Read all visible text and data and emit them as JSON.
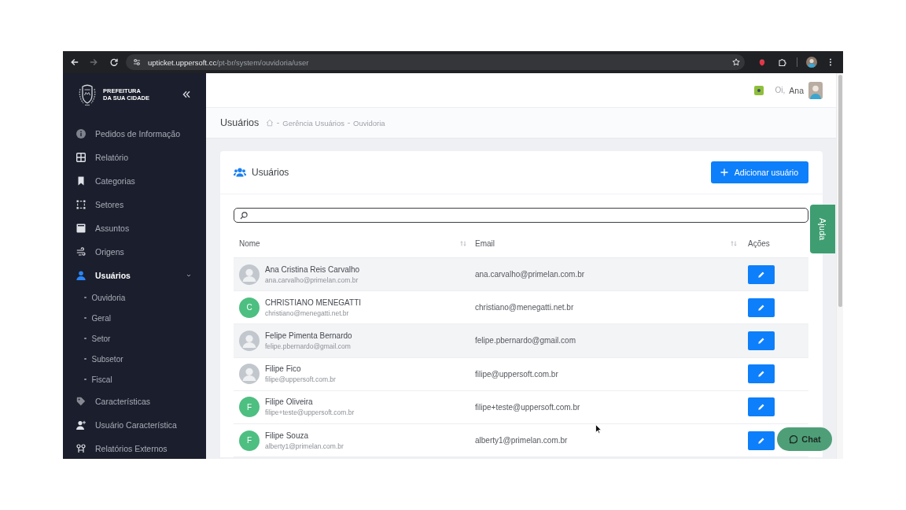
{
  "browser": {
    "back_disabled": false,
    "forward_disabled": true,
    "url": {
      "host": "upticket.uppersoft.cc",
      "path": "/pt-br/system/ouvidoria/user"
    }
  },
  "sidebar": {
    "brand": [
      "PREFEITURA",
      "DA SUA CIDADE"
    ],
    "items": [
      {
        "label": "Pedidos de Informação",
        "selected": false
      },
      {
        "label": "Relatório",
        "selected": false
      },
      {
        "label": "Categorias",
        "selected": false
      },
      {
        "label": "Setores",
        "selected": false
      },
      {
        "label": "Assuntos",
        "selected": false
      },
      {
        "label": "Origens",
        "selected": false
      },
      {
        "label": "Usuários",
        "selected": true,
        "expanded": true,
        "children": [
          {
            "label": "Ouvidoria"
          },
          {
            "label": "Geral"
          },
          {
            "label": "Setor"
          },
          {
            "label": "Subsetor"
          },
          {
            "label": "Fiscal"
          }
        ]
      },
      {
        "label": "Características",
        "selected": false
      },
      {
        "label": "Usuário Característica",
        "selected": false
      },
      {
        "label": "Relatórios Externos",
        "selected": false
      }
    ]
  },
  "header": {
    "greeting": "Oi,",
    "user_name": "Ana"
  },
  "page": {
    "title": "Usuários",
    "breadcrumb": [
      "Gerência Usuários",
      "Ouvidoria"
    ]
  },
  "card": {
    "title": "Usuários",
    "add_button": "Adicionar usuário",
    "table": {
      "columns": [
        {
          "label": "Nome",
          "sortable": true
        },
        {
          "label": "Email",
          "sortable": true
        },
        {
          "label": "Ações",
          "sortable": false
        }
      ],
      "rows": [
        {
          "name": "Ana Cristina Reis Carvalho",
          "sub_email": "ana.carvalho@primelan.com.br",
          "email": "ana.carvalho@primelan.com.br",
          "avatar": {
            "kind": "photo"
          },
          "shaded": true
        },
        {
          "name": "CHRISTIANO MENEGATTI",
          "sub_email": "christiano@menegatti.net.br",
          "email": "christiano@menegatti.net.br",
          "avatar": {
            "kind": "initial",
            "letter": "C"
          },
          "shaded": false
        },
        {
          "name": "Felipe Pimenta Bernardo",
          "sub_email": "felipe.pbernardo@gmail.com",
          "email": "felipe.pbernardo@gmail.com",
          "avatar": {
            "kind": "photo"
          },
          "shaded": true
        },
        {
          "name": "Filipe Fico",
          "sub_email": "filipe@uppersoft.com.br",
          "email": "filipe@uppersoft.com.br",
          "avatar": {
            "kind": "photo"
          },
          "shaded": false
        },
        {
          "name": "Filipe Oliveira",
          "sub_email": "filipe+teste@uppersoft.com.br",
          "email": "filipe+teste@uppersoft.com.br",
          "avatar": {
            "kind": "initial",
            "letter": "F"
          },
          "shaded": false
        },
        {
          "name": "Filipe Souza",
          "sub_email": "alberty1@primelan.com.br",
          "email": "alberty1@primelan.com.br",
          "avatar": {
            "kind": "initial",
            "letter": "F"
          },
          "shaded": false
        }
      ]
    }
  },
  "help_tab": {
    "label": "Ajuda"
  },
  "chat_button": {
    "label": "Chat"
  }
}
